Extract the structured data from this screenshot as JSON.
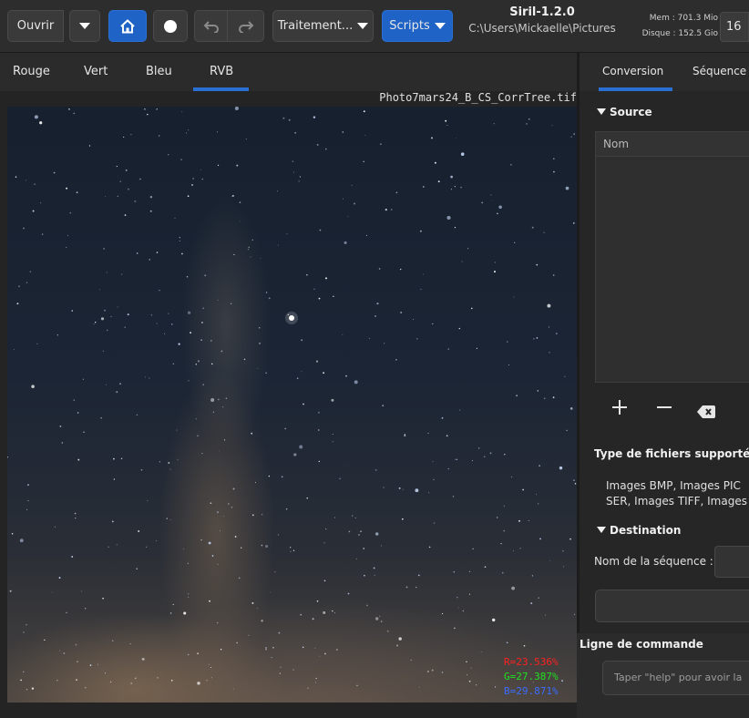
{
  "toolbar": {
    "open_label": "Ouvrir",
    "processing_label": "Traitement...",
    "scripts_label": "Scripts"
  },
  "app": {
    "title": "Siril-1.2.0",
    "path": "C:\\Users\\Mickaelle\\Pictures"
  },
  "status": {
    "memory": "Mem : 701.3 Mio",
    "disk": "Disque : 152.5 Gio",
    "threads": "16"
  },
  "channel_tabs": [
    "Rouge",
    "Vert",
    "Bleu",
    "RVB"
  ],
  "image": {
    "filename": "Photo7mars24_B_CS_CorrTree.tif",
    "pixel": {
      "r": "R=23.536%",
      "g": "G=27.387%",
      "b": "B=29.871%"
    }
  },
  "right_tabs": [
    "Conversion",
    "Séquence"
  ],
  "conversion": {
    "source_label": "Source",
    "column_name": "Nom",
    "supported_types_label": "Type de fichiers supportés :",
    "supported_types_line1": "Images BMP, Images PIC",
    "supported_types_line2": "SER, Images TIFF, Images",
    "destination_label": "Destination",
    "sequence_name_label": "Nom de la séquence :"
  },
  "command": {
    "label": "Ligne de commande",
    "placeholder": "Taper \"help\" pour avoir la"
  },
  "colors": {
    "accent": "#1f63c6",
    "background": "#242424"
  }
}
